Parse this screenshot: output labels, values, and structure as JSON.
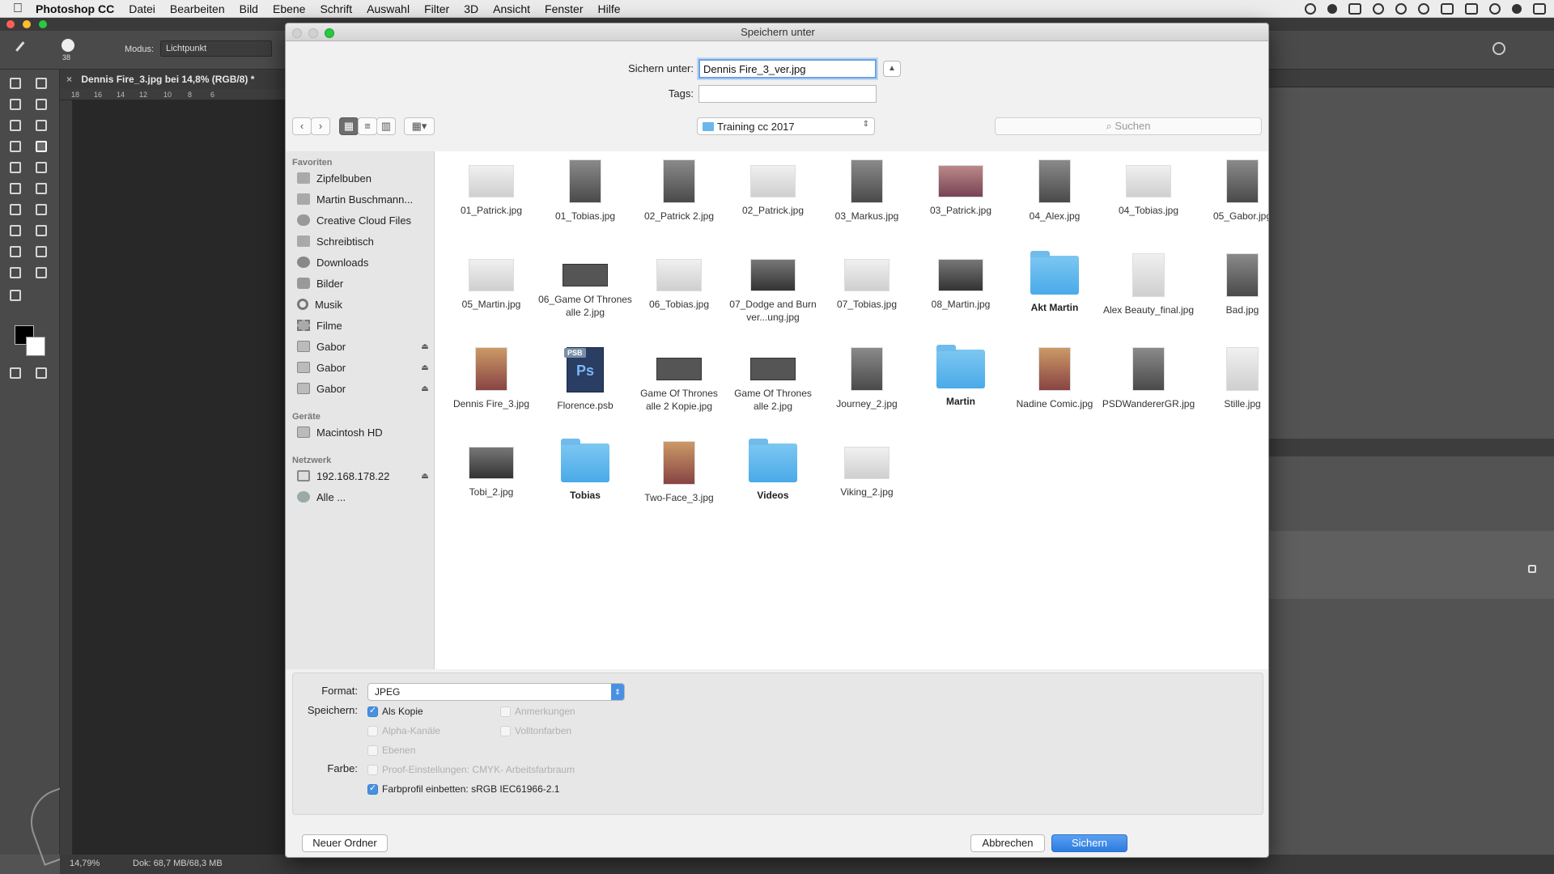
{
  "menubar": {
    "app": "Photoshop CC",
    "items": [
      "Datei",
      "Bearbeiten",
      "Bild",
      "Ebene",
      "Schrift",
      "Auswahl",
      "Filter",
      "3D",
      "Ansicht",
      "Fenster",
      "Hilfe"
    ]
  },
  "options": {
    "brush_size": "38",
    "mode_label": "Modus:",
    "mode_value": "Lichtpunkt"
  },
  "document_tab": {
    "title": "Dennis Fire_3.jpg bei 14,8% (RGB/8) *"
  },
  "ruler": {
    "ticks": [
      "18",
      "16",
      "14",
      "12",
      "10",
      "8",
      "6"
    ]
  },
  "statusbar": {
    "zoom": "14,79%",
    "doc": "Dok: 68,7 MB/68,3 MB"
  },
  "dialog": {
    "title": "Speichern unter",
    "saveas_label": "Sichern unter:",
    "saveas_value": "Dennis Fire_3_ver.jpg",
    "tags_label": "Tags:",
    "location": "Training cc 2017",
    "search_placeholder": "Suchen",
    "sidebar": {
      "favorites_header": "Favoriten",
      "favorites": [
        {
          "label": "Zipfelbuben",
          "icon": "folder-icon"
        },
        {
          "label": "Martin Buschmann...",
          "icon": "folder-icon"
        },
        {
          "label": "Creative Cloud Files",
          "icon": "creative-cloud-icon"
        },
        {
          "label": "Schreibtisch",
          "icon": "folder-icon"
        },
        {
          "label": "Downloads",
          "icon": "downloads-icon"
        },
        {
          "label": "Bilder",
          "icon": "camera-icon"
        },
        {
          "label": "Musik",
          "icon": "music-icon"
        },
        {
          "label": "Filme",
          "icon": "film-icon"
        },
        {
          "label": "Gabor",
          "icon": "disk-icon"
        },
        {
          "label": "Gabor",
          "icon": "disk-icon"
        },
        {
          "label": "Gabor",
          "icon": "disk-icon"
        }
      ],
      "devices_header": "Geräte",
      "devices": [
        {
          "label": "Macintosh HD",
          "icon": "disk-icon"
        }
      ],
      "network_header": "Netzwerk",
      "network": [
        {
          "label": "192.168.178.22",
          "icon": "network-display-icon"
        },
        {
          "label": "Alle ...",
          "icon": "globe-icon"
        }
      ]
    },
    "files": [
      {
        "name": "01_Patrick.jpg",
        "kind": "landscape light"
      },
      {
        "name": "01_Tobias.jpg",
        "kind": "portrait"
      },
      {
        "name": "02_Patrick 2.jpg",
        "kind": "portrait"
      },
      {
        "name": "02_Patrick.jpg",
        "kind": "landscape light"
      },
      {
        "name": "03_Markus.jpg",
        "kind": "portrait"
      },
      {
        "name": "03_Patrick.jpg",
        "kind": "landscape red"
      },
      {
        "name": "04_Alex.jpg",
        "kind": "portrait"
      },
      {
        "name": "04_Tobias.jpg",
        "kind": "landscape light"
      },
      {
        "name": "05_Gabor.jpg",
        "kind": "portrait"
      },
      {
        "name": "05_Martin.jpg",
        "kind": "landscape light"
      },
      {
        "name": "06_Game Of Thrones alle 2.jpg",
        "kind": "strip"
      },
      {
        "name": "06_Tobias.jpg",
        "kind": "landscape light"
      },
      {
        "name": "07_Dodge and Burn ver...ung.jpg",
        "kind": "landscape dark"
      },
      {
        "name": "07_Tobias.jpg",
        "kind": "landscape light"
      },
      {
        "name": "08_Martin.jpg",
        "kind": "landscape dark"
      },
      {
        "name": "Akt Martin",
        "kind": "folder"
      },
      {
        "name": "Alex Beauty_final.jpg",
        "kind": "portrait light"
      },
      {
        "name": "Bad.jpg",
        "kind": "portrait"
      },
      {
        "name": "Dennis Fire_3.jpg",
        "kind": "portrait warm"
      },
      {
        "name": "Florence.psb",
        "kind": "psb"
      },
      {
        "name": "Game Of Thrones alle 2 Kopie.jpg",
        "kind": "strip"
      },
      {
        "name": "Game Of Thrones alle 2.jpg",
        "kind": "strip"
      },
      {
        "name": "Journey_2.jpg",
        "kind": "portrait"
      },
      {
        "name": "Martin",
        "kind": "folder"
      },
      {
        "name": "Nadine Comic.jpg",
        "kind": "portrait warm"
      },
      {
        "name": "PSDWandererGR.jpg",
        "kind": "portrait"
      },
      {
        "name": "Stille.jpg",
        "kind": "portrait light"
      },
      {
        "name": "Tobi_2.jpg",
        "kind": "landscape dark"
      },
      {
        "name": "Tobias",
        "kind": "folder"
      },
      {
        "name": "Two-Face_3.jpg",
        "kind": "portrait warm"
      },
      {
        "name": "Videos",
        "kind": "folder"
      },
      {
        "name": "Viking_2.jpg",
        "kind": "landscape light"
      }
    ],
    "format_label": "Format:",
    "format_value": "JPEG",
    "save_label": "Speichern:",
    "color_label": "Farbe:",
    "checkboxes": {
      "as_copy": "Als Kopie",
      "annotations": "Anmerkungen",
      "alpha": "Alpha-Kanäle",
      "spot": "Volltonfarben",
      "layers": "Ebenen",
      "proof": "Proof-Einstellungen:  CMYK- Arbeitsfarbraum",
      "embed_profile": "Farbprofil einbetten:  sRGB IEC61966-2.1"
    },
    "buttons": {
      "new_folder": "Neuer Ordner",
      "cancel": "Abbrechen",
      "save": "Sichern"
    },
    "psb_tag": "PSB",
    "psb_badge": "Ps"
  }
}
